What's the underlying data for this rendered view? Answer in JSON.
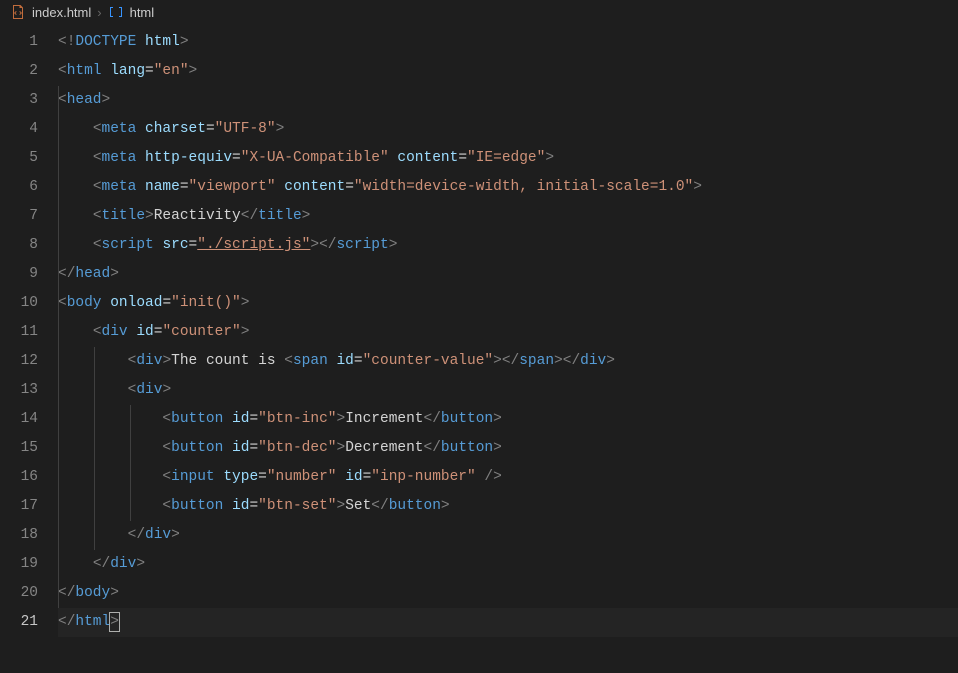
{
  "breadcrumb": {
    "file": "index.html",
    "symbol": "html",
    "separator": "›"
  },
  "lineNumbers": [
    "1",
    "2",
    "3",
    "4",
    "5",
    "6",
    "7",
    "8",
    "9",
    "10",
    "11",
    "12",
    "13",
    "14",
    "15",
    "16",
    "17",
    "18",
    "19",
    "20",
    "21"
  ],
  "activeLine": 21,
  "code": {
    "l1": {
      "doctype_open": "<!",
      "doctype": "DOCTYPE",
      "space": " ",
      "html": "html",
      "close": ">"
    },
    "l2": {
      "open": "<",
      "tag": "html",
      "a1": "lang",
      "eq": "=",
      "v1": "\"en\"",
      "close": ">"
    },
    "l3": {
      "open": "<",
      "tag": "head",
      "close": ">"
    },
    "l4": {
      "open": "<",
      "tag": "meta",
      "a1": "charset",
      "eq": "=",
      "v1": "\"UTF-8\"",
      "close": ">"
    },
    "l5": {
      "open": "<",
      "tag": "meta",
      "a1": "http-equiv",
      "eq": "=",
      "v1": "\"X-UA-Compatible\"",
      "a2": "content",
      "v2": "\"IE=edge\"",
      "close": ">"
    },
    "l6": {
      "open": "<",
      "tag": "meta",
      "a1": "name",
      "eq": "=",
      "v1": "\"viewport\"",
      "a2": "content",
      "v2": "\"width=device-width, initial-scale=1.0\"",
      "close": ">"
    },
    "l7": {
      "open": "<",
      "tag": "title",
      "close": ">",
      "text": "Reactivity",
      "copen": "</",
      "ctag": "title",
      "cclose": ">"
    },
    "l8": {
      "open": "<",
      "tag": "script",
      "a1": "src",
      "eq": "=",
      "v1": "\"./script.js\"",
      "close": ">",
      "copen": "</",
      "ctag": "script",
      "cclose": ">"
    },
    "l9": {
      "copen": "</",
      "ctag": "head",
      "cclose": ">"
    },
    "l10": {
      "open": "<",
      "tag": "body",
      "a1": "onload",
      "eq": "=",
      "v1": "\"init()\"",
      "close": ">"
    },
    "l11": {
      "open": "<",
      "tag": "div",
      "a1": "id",
      "eq": "=",
      "v1": "\"counter\"",
      "close": ">"
    },
    "l12": {
      "open": "<",
      "tag": "div",
      "close": ">",
      "text1": "The count is ",
      "sopen": "<",
      "stag": "span",
      "sa1": "id",
      "seq": "=",
      "sv1": "\"counter-value\"",
      "sclose": ">",
      "scopen": "</",
      "sctag": "span",
      "scclose": ">",
      "copen": "</",
      "ctag": "div",
      "cclose": ">"
    },
    "l13": {
      "open": "<",
      "tag": "div",
      "close": ">"
    },
    "l14": {
      "open": "<",
      "tag": "button",
      "a1": "id",
      "eq": "=",
      "v1": "\"btn-inc\"",
      "close": ">",
      "text": "Increment",
      "copen": "</",
      "ctag": "button",
      "cclose": ">"
    },
    "l15": {
      "open": "<",
      "tag": "button",
      "a1": "id",
      "eq": "=",
      "v1": "\"btn-dec\"",
      "close": ">",
      "text": "Decrement",
      "copen": "</",
      "ctag": "button",
      "cclose": ">"
    },
    "l16": {
      "open": "<",
      "tag": "input",
      "a1": "type",
      "eq": "=",
      "v1": "\"number\"",
      "a2": "id",
      "v2": "\"inp-number\"",
      "close": " />"
    },
    "l17": {
      "open": "<",
      "tag": "button",
      "a1": "id",
      "eq": "=",
      "v1": "\"btn-set\"",
      "close": ">",
      "text": "Set",
      "copen": "</",
      "ctag": "button",
      "cclose": ">"
    },
    "l18": {
      "copen": "</",
      "ctag": "div",
      "cclose": ">"
    },
    "l19": {
      "copen": "</",
      "ctag": "div",
      "cclose": ">"
    },
    "l20": {
      "copen": "</",
      "ctag": "body",
      "cclose": ">"
    },
    "l21": {
      "copen": "</",
      "ctag": "html",
      "cclose": ">"
    }
  }
}
